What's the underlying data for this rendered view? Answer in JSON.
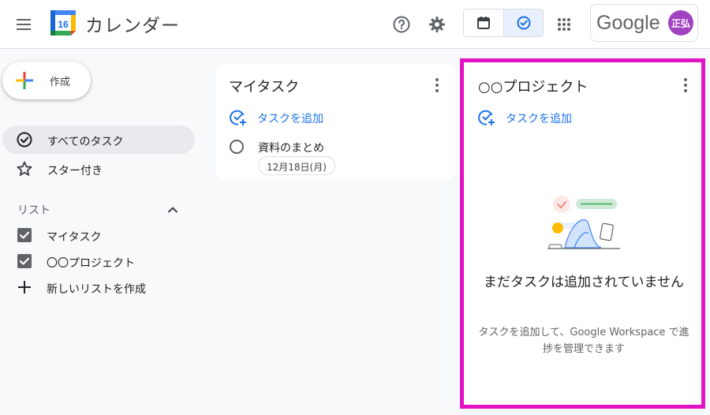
{
  "header": {
    "app_title": "カレンダー",
    "logo_day": "16",
    "google_word": "Google",
    "avatar_initials": "正弘"
  },
  "sidebar": {
    "create_label": "作成",
    "nav": [
      {
        "label": "すべてのタスク",
        "icon": "task-check-icon",
        "active": true
      },
      {
        "label": "スター付き",
        "icon": "star-icon",
        "active": false
      }
    ],
    "lists_title": "リスト",
    "lists": [
      {
        "label": "マイタスク",
        "checked": true
      },
      {
        "label": "〇〇プロジェクト",
        "checked": true
      }
    ],
    "new_list_label": "新しいリストを作成"
  },
  "cards": [
    {
      "title": "マイタスク",
      "add_task_label": "タスクを追加",
      "tasks": [
        {
          "title": "資料のまとめ",
          "date": "12月18日(月)"
        }
      ]
    },
    {
      "title": "○○プロジェクト",
      "add_task_label": "タスクを追加",
      "empty_title": "まだタスクは追加されていません",
      "empty_sub": "タスクを追加して、Google Workspace で進捗を管理できます",
      "highlight_color": "#e213c3"
    }
  ],
  "colors": {
    "accent": "#1a73e8",
    "active_toggle": "#e8f0fe",
    "avatar": "#a142c1"
  }
}
